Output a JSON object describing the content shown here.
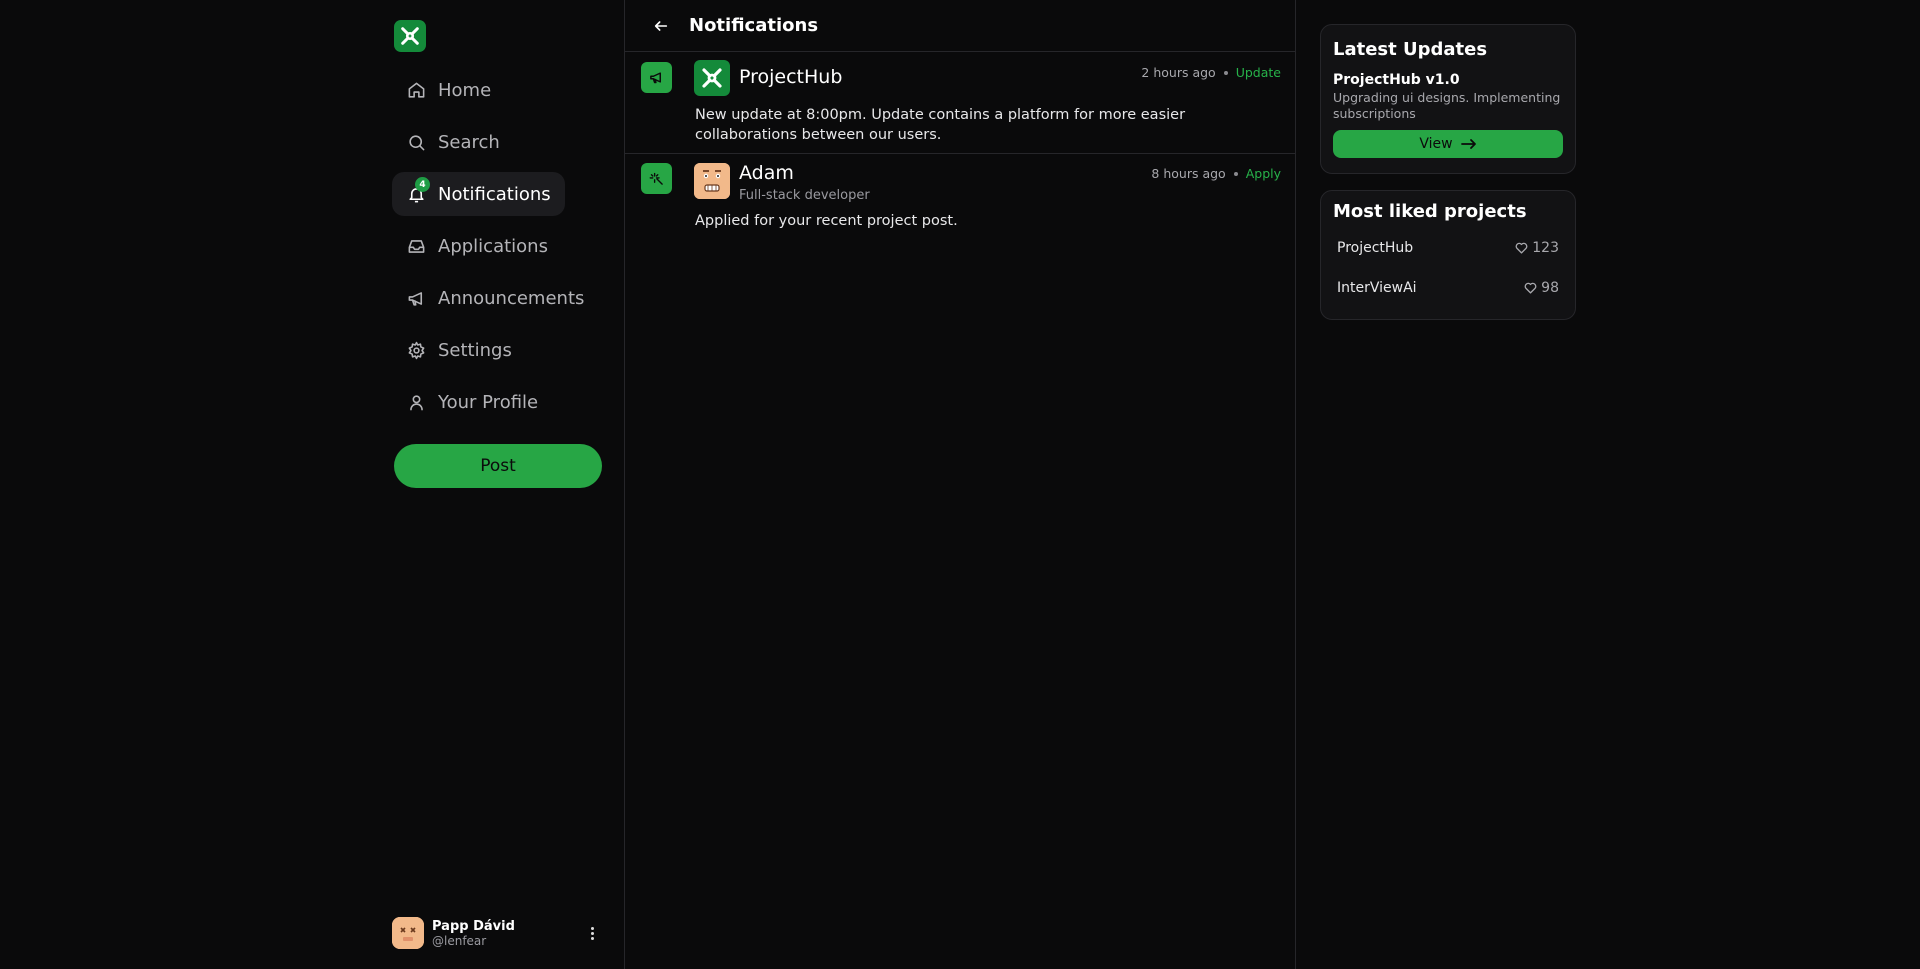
{
  "colors": {
    "accent": "#27a645",
    "background": "#0a0a0b",
    "card": "#121214"
  },
  "sidebar": {
    "logo_icon": "projecthub-logo-icon",
    "items": [
      {
        "label": "Home",
        "icon": "home-icon"
      },
      {
        "label": "Search",
        "icon": "search-icon"
      },
      {
        "label": "Notifications",
        "icon": "bell-icon",
        "badge": "4",
        "active": true
      },
      {
        "label": "Applications",
        "icon": "inbox-icon"
      },
      {
        "label": "Announcements",
        "icon": "megaphone-icon"
      },
      {
        "label": "Settings",
        "icon": "gear-icon"
      },
      {
        "label": "Your Profile",
        "icon": "user-icon"
      }
    ],
    "post_label": "Post",
    "user": {
      "name": "Papp Dávid",
      "handle": "@lenfear"
    }
  },
  "main": {
    "title": "Notifications",
    "notifications": [
      {
        "type_icon": "megaphone-icon",
        "name": "ProjectHub",
        "time": "2 hours ago",
        "action": "Update",
        "body": "New update at 8:00pm. Update contains a platform for more easier collaborations between our users."
      },
      {
        "type_icon": "sparkle-icon",
        "name": "Adam",
        "subtitle": "Full-stack developer",
        "time": "8 hours ago",
        "action": "Apply",
        "body": "Applied for your recent project post."
      }
    ]
  },
  "right": {
    "updates": {
      "heading": "Latest Updates",
      "title": "ProjectHub v1.0",
      "description": "Upgrading ui designs. Implementing subscriptions",
      "view_label": "View"
    },
    "liked": {
      "heading": "Most liked projects",
      "items": [
        {
          "name": "ProjectHub",
          "likes": "123"
        },
        {
          "name": "InterViewAi",
          "likes": "98"
        }
      ]
    }
  }
}
